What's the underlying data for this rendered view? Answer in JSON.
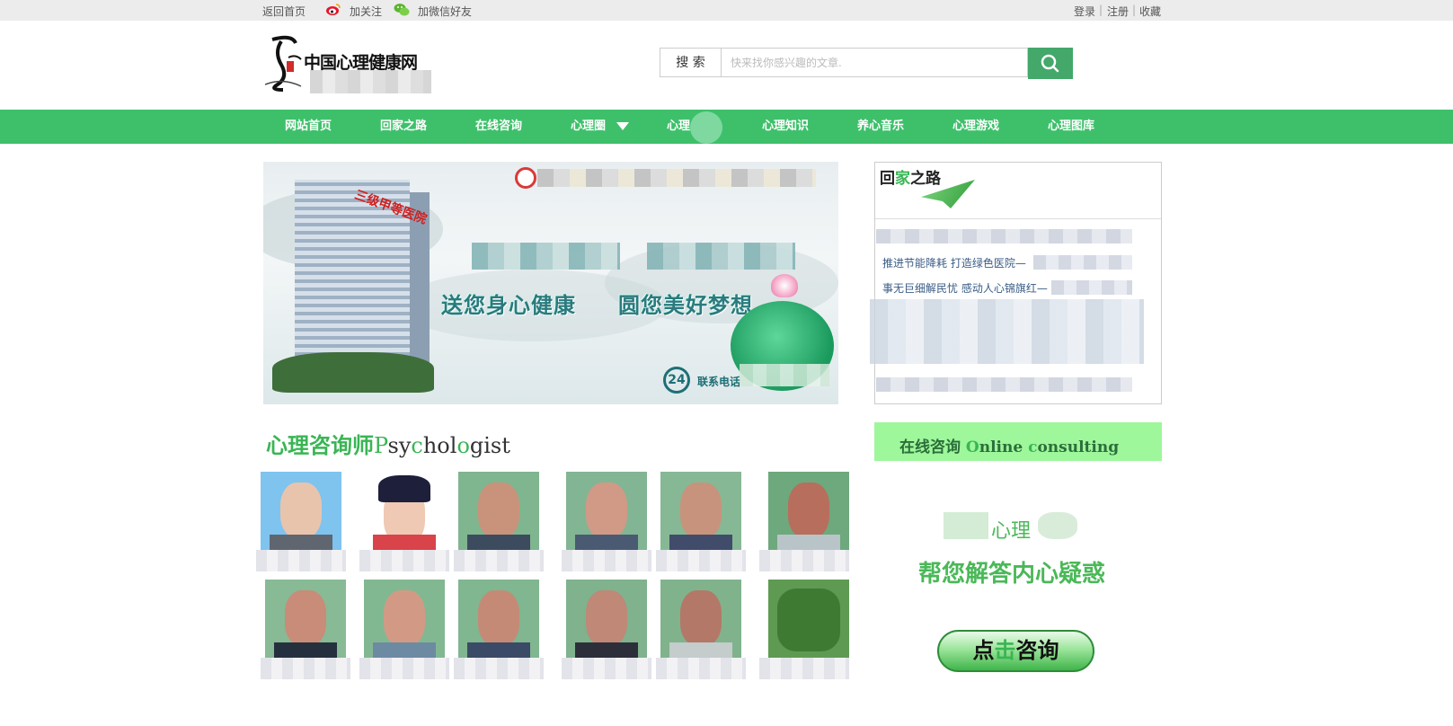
{
  "topbar": {
    "home_link": "返回首页",
    "follow_link": "加关注",
    "wechat_link": "加微信好友",
    "login": "登录",
    "register": "注册",
    "favorite": "收藏"
  },
  "header": {
    "logo_text": "中国心理健康网",
    "search_label": "搜 索",
    "search_placeholder": "快来找你感兴趣的文章."
  },
  "nav": {
    "items": [
      "网站首页",
      "回家之路",
      "在线咨询",
      "心理圈",
      "心理",
      "心理知识",
      "养心音乐",
      "心理游戏",
      "心理图库"
    ]
  },
  "banner": {
    "hospital_sign": "三级甲等医院",
    "slogan_left": "送您身心健康",
    "slogan_right": "圆您美好梦想",
    "hours": "24",
    "phone_label": "联系电话"
  },
  "psychologists": {
    "title_cn": "心理咨询师",
    "title_en_parts": [
      "P",
      "sy",
      "c",
      "hol",
      "o",
      "gist"
    ]
  },
  "sidebar": {
    "title_parts": [
      "回",
      "家",
      "之路"
    ],
    "news": [
      "推进节能降耗 打造绿色医院—",
      "事无巨细解民忧 感动人心锦旗红—"
    ],
    "consult_title": {
      "cn": "在线咨询",
      "en_parts": [
        "O",
        "nline ",
        "c",
        "onsulting"
      ]
    },
    "promo_line1": "心理",
    "promo_line2": "帮您解答内心疑惑",
    "click_button_parts": [
      "点",
      "击",
      "咨询"
    ]
  },
  "colors": {
    "nav_green": "#3ec06b",
    "search_button": "#43a86a",
    "title_green": "#39b554",
    "consult_bg": "#9ef79b",
    "link_blue": "#3a5c86"
  }
}
